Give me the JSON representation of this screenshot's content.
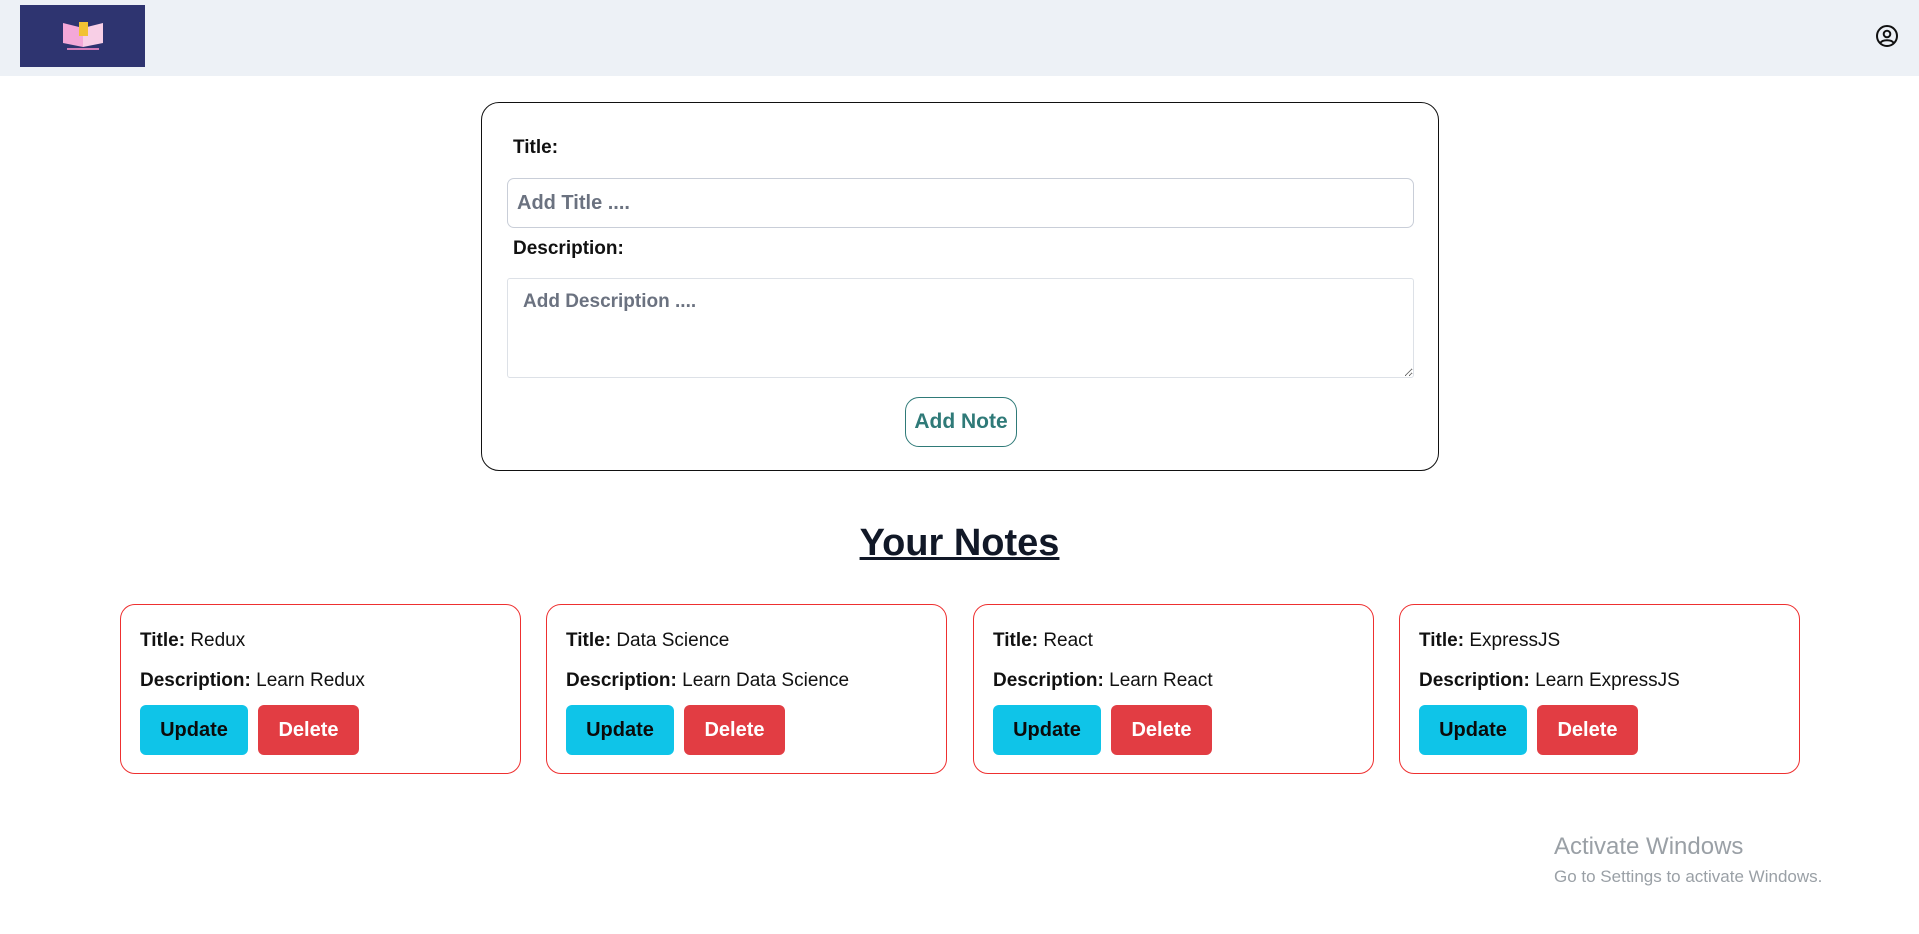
{
  "form": {
    "title_label": "Title:",
    "title_placeholder": "Add Title ....",
    "description_label": "Description:",
    "description_placeholder": "Add Description ....",
    "submit_label": "Add Note"
  },
  "notes_heading": "Your Notes",
  "note_labels": {
    "title": "Title:",
    "description": "Description:"
  },
  "notes": [
    {
      "title": "Redux",
      "description": "Learn Redux",
      "update_label": "Update",
      "delete_label": "Delete"
    },
    {
      "title": "Data Science",
      "description": "Learn Data Science",
      "update_label": "Update",
      "delete_label": "Delete"
    },
    {
      "title": "React",
      "description": "Learn React",
      "update_label": "Update",
      "delete_label": "Delete"
    },
    {
      "title": "ExpressJS",
      "description": "Learn ExpressJS",
      "update_label": "Update",
      "delete_label": "Delete"
    }
  ],
  "watermark": {
    "title": "Activate Windows",
    "subtitle": "Go to Settings to activate Windows."
  },
  "icons": {
    "logo": "book-logo-icon",
    "profile": "user-circle-icon"
  },
  "colors": {
    "navbar_bg": "#edf1f6",
    "update_btn": "#0fc4e8",
    "delete_btn": "#e23d43",
    "card_border": "#ee3030",
    "add_btn": "#2f7a78"
  }
}
